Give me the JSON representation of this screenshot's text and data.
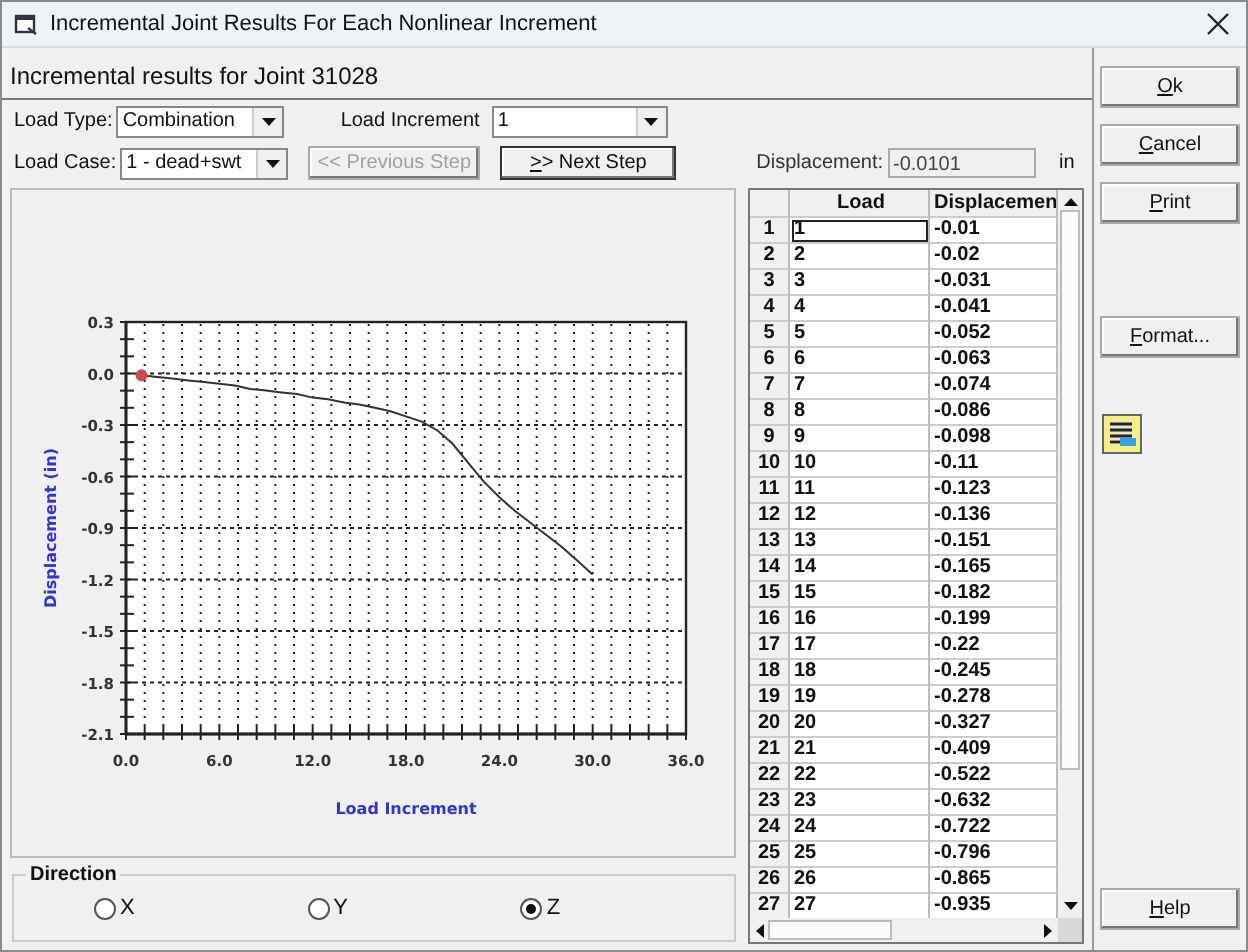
{
  "window": {
    "title": "Incremental Joint Results For Each Nonlinear Increment"
  },
  "header": "Incremental results for Joint 31028",
  "controls": {
    "load_type": {
      "label": "Load Type:",
      "value": "Combination"
    },
    "load_increment": {
      "label": "Load Increment",
      "value": "1"
    },
    "load_case": {
      "label": "Load Case:",
      "value": "1 - dead+swt"
    },
    "previous_step": {
      "label": "<< Previous Step",
      "disabled": true
    },
    "next_step": {
      "label": ">> Next Step",
      "disabled": false
    },
    "displacement": {
      "label": "Displacement:",
      "value": "-0.0101",
      "unit": "in",
      "disabled": true
    }
  },
  "chart": {
    "chart_data": {
      "type": "line",
      "xlabel": "Load Increment",
      "ylabel": "Displacement (in)",
      "x": [
        1,
        2,
        3,
        4,
        5,
        6,
        7,
        8,
        9,
        10,
        11,
        12,
        13,
        14,
        15,
        16,
        17,
        18,
        19,
        20,
        21,
        22,
        23,
        24,
        25,
        26,
        27,
        28,
        29,
        30
      ],
      "series": [
        {
          "color": "#333333",
          "values": [
            -0.01,
            -0.02,
            -0.03,
            -0.04,
            -0.05,
            -0.06,
            -0.07,
            -0.09,
            -0.1,
            -0.11,
            -0.12,
            -0.14,
            -0.15,
            -0.17,
            -0.18,
            -0.2,
            -0.22,
            -0.25,
            -0.28,
            -0.33,
            -0.41,
            -0.52,
            -0.63,
            -0.72,
            -0.8,
            -0.87,
            -0.94,
            -1.01,
            -1.09,
            -1.17
          ]
        }
      ],
      "grid": true,
      "xlim": [
        0,
        36
      ],
      "ylim": [
        -2.1,
        0.3
      ],
      "xticks": [
        {
          "value": 0,
          "label": "0.0"
        },
        {
          "value": 6,
          "label": "6.0"
        },
        {
          "value": 12,
          "label": "12.0"
        },
        {
          "value": 18,
          "label": "18.0"
        },
        {
          "value": 24,
          "label": "24.0"
        },
        {
          "value": 30,
          "label": "30.0"
        },
        {
          "value": 36,
          "label": "36.0"
        }
      ],
      "yticks": [
        {
          "value": 0.3,
          "label": "0.3"
        },
        {
          "value": 0,
          "label": "0.0"
        },
        {
          "value": -0.3,
          "label": "-0.3"
        },
        {
          "value": -0.6,
          "label": "-0.6"
        },
        {
          "value": -0.9,
          "label": "-0.9"
        },
        {
          "value": -1.2,
          "label": "-1.2"
        },
        {
          "value": -1.5,
          "label": "-1.5"
        },
        {
          "value": -1.8,
          "label": "-1.8"
        },
        {
          "value": -2.1,
          "label": "-2.1"
        }
      ]
    }
  },
  "table": {
    "columns": [
      "Load",
      "Displacemen"
    ],
    "rows": [
      {
        "index": "1",
        "cells": [
          "1",
          "-0.01"
        ],
        "focused": true
      },
      {
        "index": "2",
        "cells": [
          "2",
          "-0.02"
        ],
        "focused": false
      },
      {
        "index": "3",
        "cells": [
          "3",
          "-0.031"
        ],
        "focused": false
      },
      {
        "index": "4",
        "cells": [
          "4",
          "-0.041"
        ],
        "focused": false
      },
      {
        "index": "5",
        "cells": [
          "5",
          "-0.052"
        ],
        "focused": false
      },
      {
        "index": "6",
        "cells": [
          "6",
          "-0.063"
        ],
        "focused": false
      },
      {
        "index": "7",
        "cells": [
          "7",
          "-0.074"
        ],
        "focused": false
      },
      {
        "index": "8",
        "cells": [
          "8",
          "-0.086"
        ],
        "focused": false
      },
      {
        "index": "9",
        "cells": [
          "9",
          "-0.098"
        ],
        "focused": false
      },
      {
        "index": "10",
        "cells": [
          "10",
          "-0.11"
        ],
        "focused": false
      },
      {
        "index": "11",
        "cells": [
          "11",
          "-0.123"
        ],
        "focused": false
      },
      {
        "index": "12",
        "cells": [
          "12",
          "-0.136"
        ],
        "focused": false
      },
      {
        "index": "13",
        "cells": [
          "13",
          "-0.151"
        ],
        "focused": false
      },
      {
        "index": "14",
        "cells": [
          "14",
          "-0.165"
        ],
        "focused": false
      },
      {
        "index": "15",
        "cells": [
          "15",
          "-0.182"
        ],
        "focused": false
      },
      {
        "index": "16",
        "cells": [
          "16",
          "-0.199"
        ],
        "focused": false
      },
      {
        "index": "17",
        "cells": [
          "17",
          "-0.22"
        ],
        "focused": false
      },
      {
        "index": "18",
        "cells": [
          "18",
          "-0.245"
        ],
        "focused": false
      },
      {
        "index": "19",
        "cells": [
          "19",
          "-0.278"
        ],
        "focused": false
      },
      {
        "index": "20",
        "cells": [
          "20",
          "-0.327"
        ],
        "focused": false
      },
      {
        "index": "21",
        "cells": [
          "21",
          "-0.409"
        ],
        "focused": false
      },
      {
        "index": "22",
        "cells": [
          "22",
          "-0.522"
        ],
        "focused": false
      },
      {
        "index": "23",
        "cells": [
          "23",
          "-0.632"
        ],
        "focused": false
      },
      {
        "index": "24",
        "cells": [
          "24",
          "-0.722"
        ],
        "focused": false
      },
      {
        "index": "25",
        "cells": [
          "25",
          "-0.796"
        ],
        "focused": false
      },
      {
        "index": "26",
        "cells": [
          "26",
          "-0.865"
        ],
        "focused": false
      },
      {
        "index": "27",
        "cells": [
          "27",
          "-0.935"
        ],
        "focused": false
      }
    ]
  },
  "direction": {
    "title": "Direction",
    "options": [
      {
        "label": "X",
        "selected": false
      },
      {
        "label": "Y",
        "selected": false
      },
      {
        "label": "Z",
        "selected": true
      }
    ]
  },
  "buttons_top": [
    "Ok",
    "Cancel",
    "Print"
  ],
  "format_button": "Format...",
  "help_button": "Help"
}
